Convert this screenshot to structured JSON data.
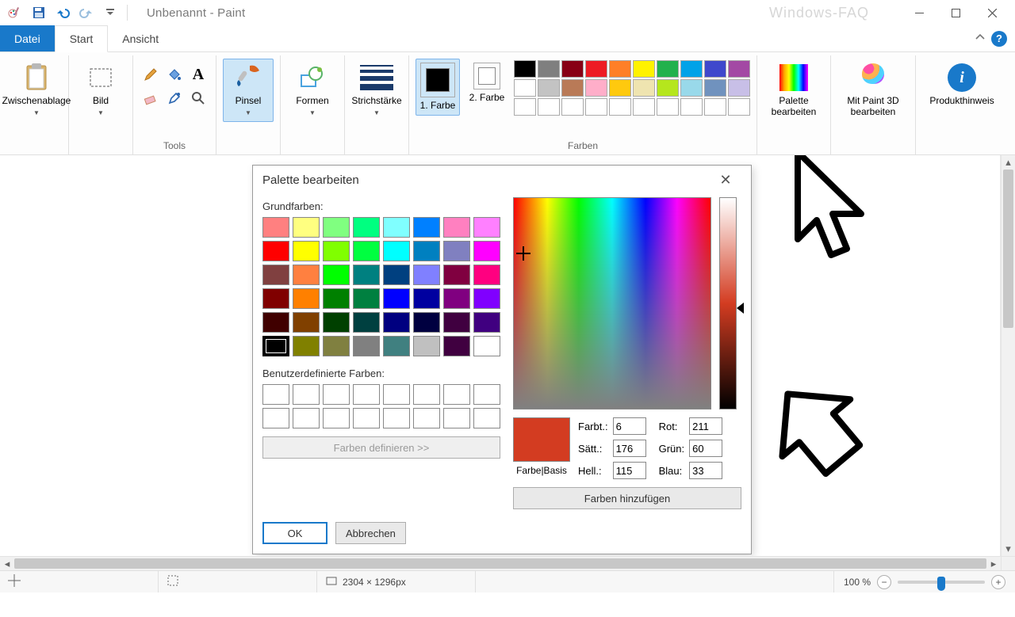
{
  "app": {
    "title": "Unbenannt - Paint",
    "watermark": "Windows-FAQ"
  },
  "tabs": {
    "file": "Datei",
    "home": "Start",
    "view": "Ansicht"
  },
  "ribbon": {
    "clipboard": {
      "label": "Zwischenablage"
    },
    "image": {
      "label": "Bild"
    },
    "tools_group": "Tools",
    "brushes": {
      "label": "Pinsel"
    },
    "shapes": {
      "label": "Formen"
    },
    "stroke": {
      "label": "Strichstärke"
    },
    "color1": {
      "label": "1. Farbe"
    },
    "color2": {
      "label": "2. Farbe"
    },
    "colors_group": "Farben",
    "edit_palette": {
      "label": "Palette bearbeiten"
    },
    "paint3d": {
      "label": "Mit Paint 3D bearbeiten"
    },
    "product": {
      "label": "Produkthinweis"
    },
    "palette_row1": [
      "#000000",
      "#7f7f7f",
      "#880015",
      "#ed1c24",
      "#ff7f27",
      "#fff200",
      "#22b14c",
      "#00a2e8",
      "#3f48cc",
      "#a349a4"
    ],
    "palette_row2": [
      "#ffffff",
      "#c3c3c3",
      "#b97a57",
      "#ffaec9",
      "#ffc90e",
      "#efe4b0",
      "#b5e61d",
      "#99d9ea",
      "#7092be",
      "#c8bfe7"
    ],
    "palette_row3": [
      "#ffffff",
      "#ffffff",
      "#ffffff",
      "#ffffff",
      "#ffffff",
      "#ffffff",
      "#ffffff",
      "#ffffff",
      "#ffffff",
      "#ffffff"
    ]
  },
  "dialog": {
    "title": "Palette bearbeiten",
    "basic_label": "Grundfarben:",
    "custom_label": "Benutzerdefinierte Farben:",
    "define_btn": "Farben definieren >>",
    "ok": "OK",
    "cancel": "Abbrechen",
    "preview_label": "Farbe|Basis",
    "hue_label": "Farbt.:",
    "hue": "6",
    "sat_label": "Sätt.:",
    "sat": "176",
    "lum_label": "Hell.:",
    "lum": "115",
    "red_label": "Rot:",
    "red": "211",
    "green_label": "Grün:",
    "green": "60",
    "blue_label": "Blau:",
    "blue": "33",
    "add_btn": "Farben hinzufügen",
    "preview_color": "#d33c21",
    "basic_colors": [
      "#ff8080",
      "#ffff80",
      "#80ff80",
      "#00ff80",
      "#80ffff",
      "#0080ff",
      "#ff80c0",
      "#ff80ff",
      "#ff0000",
      "#ffff00",
      "#80ff00",
      "#00ff40",
      "#00ffff",
      "#0080c0",
      "#8080c0",
      "#ff00ff",
      "#804040",
      "#ff8040",
      "#00ff00",
      "#008080",
      "#004080",
      "#8080ff",
      "#800040",
      "#ff0080",
      "#800000",
      "#ff8000",
      "#008000",
      "#008040",
      "#0000ff",
      "#0000a0",
      "#800080",
      "#8000ff",
      "#400000",
      "#804000",
      "#004000",
      "#004040",
      "#000080",
      "#000040",
      "#400040",
      "#400080",
      "#000000",
      "#808000",
      "#808040",
      "#808080",
      "#408080",
      "#c0c0c0",
      "#400040",
      "#ffffff"
    ]
  },
  "status": {
    "dims": "2304 × 1296px",
    "zoom": "100 %"
  }
}
